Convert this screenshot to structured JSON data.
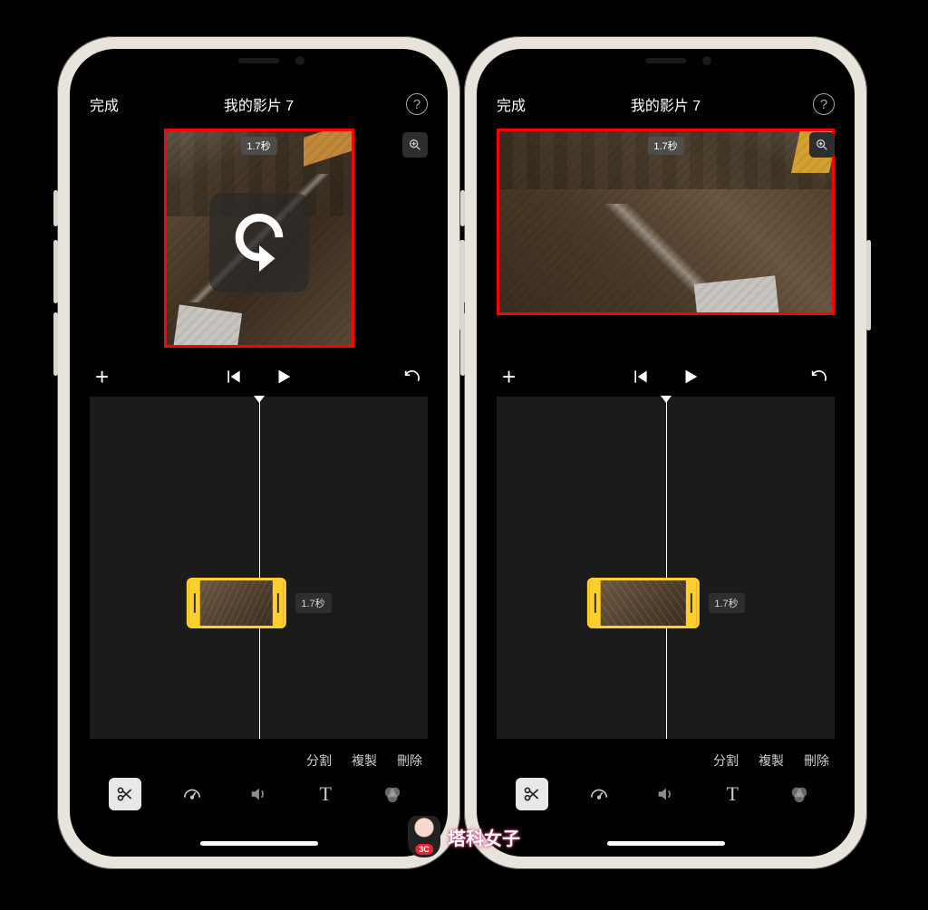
{
  "header": {
    "done_label": "完成",
    "title": "我的影片 7",
    "help_label": "?"
  },
  "preview": {
    "duration_badge": "1.7秒"
  },
  "transport": {
    "add_label": "+"
  },
  "timeline": {
    "clip_duration": "1.7秒"
  },
  "edit_actions": {
    "split": "分割",
    "duplicate": "複製",
    "delete": "刪除"
  },
  "toolbar": {
    "text_label": "T"
  },
  "watermark": {
    "text": "塔科女子",
    "badge": "3C"
  }
}
